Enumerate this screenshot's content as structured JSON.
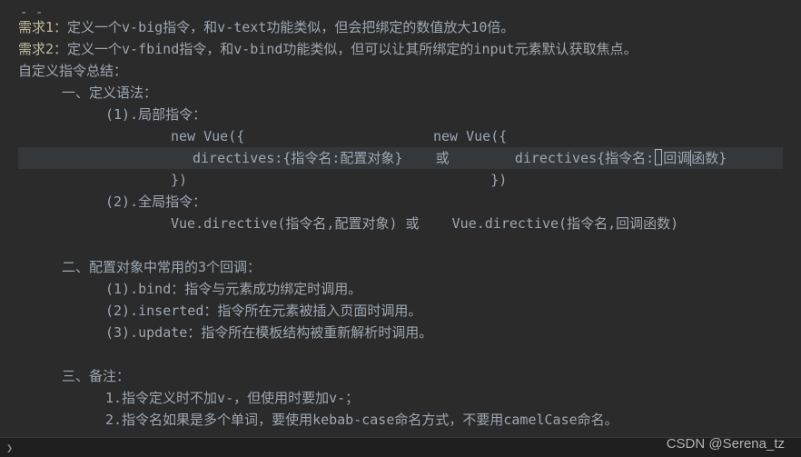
{
  "dashes": "- -",
  "req1_label": "需求1：",
  "req1_text": "定义一个v-big指令，和v-text功能类似，但会把绑定的数值放大10倍。",
  "req2_label": "需求2：",
  "req2_text": "定义一个v-fbind指令，和v-bind功能类似，但可以让其所绑定的input元素默认获取焦点。",
  "summary": "自定义指令总结：",
  "syntax_title": "一、定义语法：",
  "local_title": "(1).局部指令：",
  "code_new1": "new Vue({",
  "code_new2": "new Vue({",
  "code_dir1": "directives:{指令名:配置对象}",
  "code_or": "或",
  "code_dir2": "directives{指令名:回调函数}",
  "code_close": "})",
  "code_close2": "})",
  "global_title": "(2).全局指令：",
  "global_code": "Vue.directive(指令名,配置对象) 或    Vue.directive(指令名,回调函数)",
  "callbacks_title": "二、配置对象中常用的3个回调：",
  "cb1": "(1).bind：指令与元素成功绑定时调用。",
  "cb2": "(2).inserted：指令所在元素被插入页面时调用。",
  "cb3": "(3).update：指令所在模板结构被重新解析时调用。",
  "notes_title": "三、备注：",
  "note1": "1.指令定义时不加v-，但使用时要加v-；",
  "note2": "2.指令名如果是多个单词，要使用kebab-case命名方式，不要用camelCase命名。",
  "watermark": "CSDN @Serena_tz"
}
